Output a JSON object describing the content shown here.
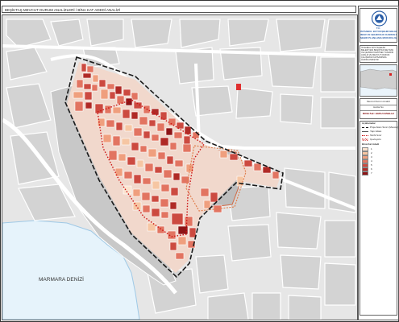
{
  "title": "BEŞİKTAŞ MEVCUT DURUM ANALİZLERİ / BİNA KAT ADEDİ ANALİZİ",
  "panel": {
    "org_line1": "T.C.",
    "org_line2": "İSTANBUL BÜYÜKŞEHİR BELEDİYESİ",
    "org_line3": "İMAR VE ŞEHİRCİLİK DAİRESİ BAŞKANLIĞI",
    "org_line4": "ŞEHİR PLANLAMA MÜDÜRLÜĞÜ",
    "project_text": "İSTANBUL BÜYÜKŞEHİR BELEDİYESİ BEŞİKTAŞ MEYDAN VE ÇEVRESİ KENTSEL TASARIM ANALİZ VE MEVCUT DURUM ÇALIŞMASI KAPSAMINDA HAZIRLANMIŞTIR",
    "section_title": "Mevcut Durum Analizi",
    "section_sub": "Harita No",
    "section_name": "BİNA KAT ADEDİ ANALİZİ",
    "legend_title": "Açıklamalar",
    "legend_lines": [
      {
        "label": "Proje Alanı Sınırı (Mevcut)",
        "style": "dash-black"
      },
      {
        "label": "Yapı Adası",
        "style": "solid-thin"
      },
      {
        "label": "Tarihi Sınır",
        "style": "dot-red"
      },
      {
        "label": "Çevreyolu",
        "style": "hatch"
      }
    ],
    "floor_title": "Bina Kat Adedi",
    "floor_classes": [
      {
        "label": "1",
        "color": "#fbe3cf"
      },
      {
        "label": "2",
        "color": "#f6c6a3"
      },
      {
        "label": "3",
        "color": "#ef9f7e"
      },
      {
        "label": "4",
        "color": "#e27461"
      },
      {
        "label": "5",
        "color": "#cc4a40"
      },
      {
        "label": "6",
        "color": "#b02a26"
      },
      {
        "label": "7",
        "color": "#8d1416"
      }
    ]
  },
  "map": {
    "sea_label": "MARMARA DENİZİ",
    "colors": {
      "background": "#e6e6e6",
      "street": "#ffffff",
      "sea": "#e6f3fb",
      "sea_edge": "#9fc9e6",
      "block": "#d0d0d0",
      "boundary": "#1a1a1a",
      "historic": "#cc1111"
    }
  }
}
